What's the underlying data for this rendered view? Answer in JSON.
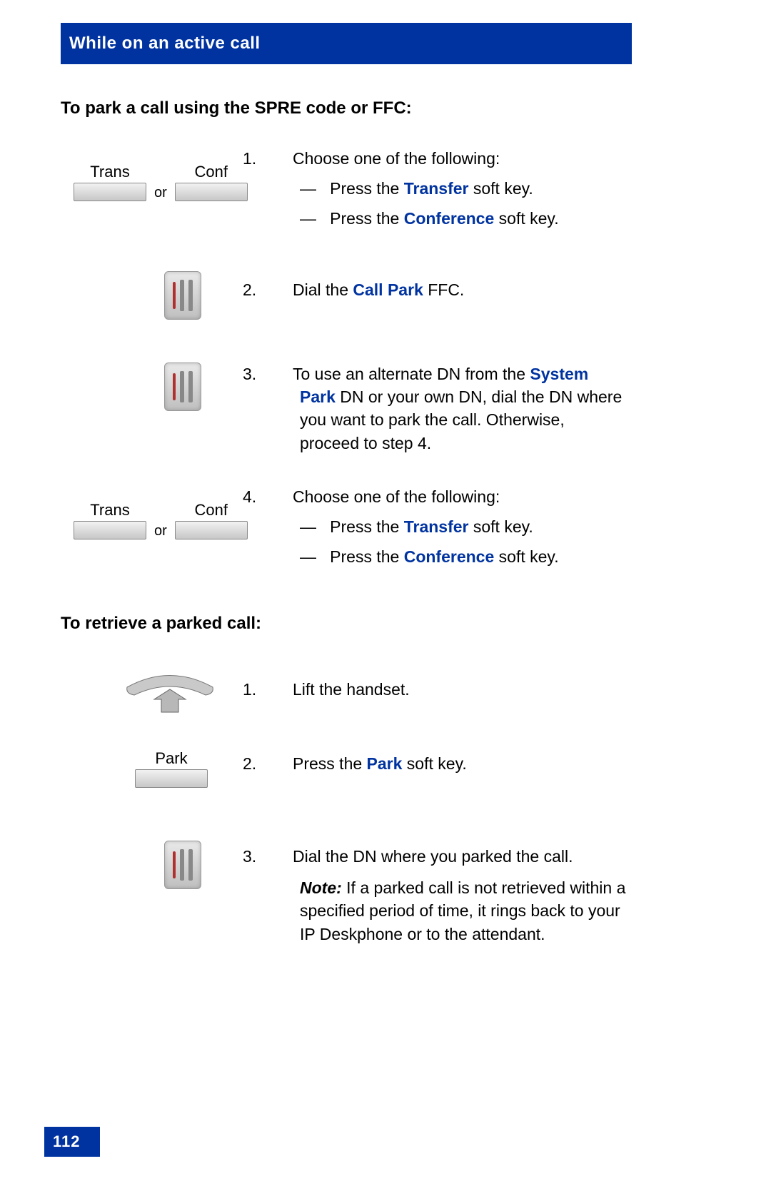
{
  "header": "While on an active call",
  "section1_title": "To park a call using the SPRE code or FFC:",
  "softkey": {
    "trans": "Trans",
    "conf": "Conf",
    "or": "or",
    "park": "Park"
  },
  "step1": {
    "num": "1.",
    "lead": "Choose one of the following:",
    "dash": "—",
    "b1_pre": "Press the ",
    "b1_kw": "Transfer",
    "b1_post": " soft key.",
    "b2_pre": "Press the ",
    "b2_kw": "Conference",
    "b2_post": " soft key."
  },
  "step2": {
    "num": "2.",
    "pre": "Dial the ",
    "kw": "Call Park",
    "post": " FFC."
  },
  "step3": {
    "num": "3.",
    "pre": "To use an alternate DN from the ",
    "kw": "System Park",
    "post": " DN or your own DN, dial the DN where you want to park the call. Otherwise, proceed to step 4."
  },
  "step4": {
    "num": "4.",
    "lead": "Choose one of the following:",
    "dash": "—",
    "b1_pre": "Press the ",
    "b1_kw": "Transfer",
    "b1_post": " soft key.",
    "b2_pre": "Press the ",
    "b2_kw": "Conference",
    "b2_post": " soft key."
  },
  "section2_title": "To retrieve a parked call:",
  "r1": {
    "num": "1.",
    "text": "Lift the handset."
  },
  "r2": {
    "num": "2.",
    "pre": "Press the ",
    "kw": "Park",
    "post": " soft key."
  },
  "r3": {
    "num": "3.",
    "line1": "Dial the DN where you parked the call.",
    "note_label": "Note:",
    "note_body": " If a parked call is not retrieved within a specified period of time, it rings back to your IP Deskphone or to the attendant."
  },
  "page_number": "112"
}
